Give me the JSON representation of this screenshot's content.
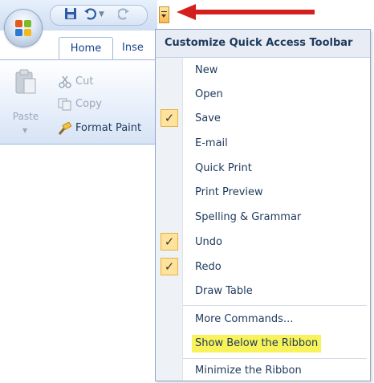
{
  "ribbon": {
    "tabs": [
      "Home",
      "Inse"
    ],
    "clipboard": {
      "paste_label": "Paste",
      "cut_label": "Cut",
      "copy_label": "Copy",
      "format_painter_label": "Format Paint"
    }
  },
  "menu": {
    "title": "Customize Quick Access Toolbar",
    "items": [
      {
        "label": "New",
        "checked": false
      },
      {
        "label": "Open",
        "checked": false
      },
      {
        "label": "Save",
        "checked": true
      },
      {
        "label": "E-mail",
        "checked": false
      },
      {
        "label": "Quick Print",
        "checked": false
      },
      {
        "label": "Print Preview",
        "checked": false
      },
      {
        "label": "Spelling & Grammar",
        "checked": false
      },
      {
        "label": "Undo",
        "checked": true
      },
      {
        "label": "Redo",
        "checked": true
      },
      {
        "label": "Draw Table",
        "checked": false
      }
    ],
    "more_commands": "More Commands...",
    "show_below": "Show Below the Ribbon",
    "minimize": "Minimize the Ribbon",
    "check_mark": "✓"
  },
  "colors": {
    "arrow": "#d41f1f",
    "highlight": "#f8f35a",
    "check_bg": "#ffe39b"
  },
  "icons": [
    "office-logo-icon",
    "save-icon",
    "undo-icon",
    "redo-icon",
    "customize-dropdown-icon",
    "paste-icon",
    "cut-icon",
    "copy-icon",
    "format-painter-icon"
  ]
}
